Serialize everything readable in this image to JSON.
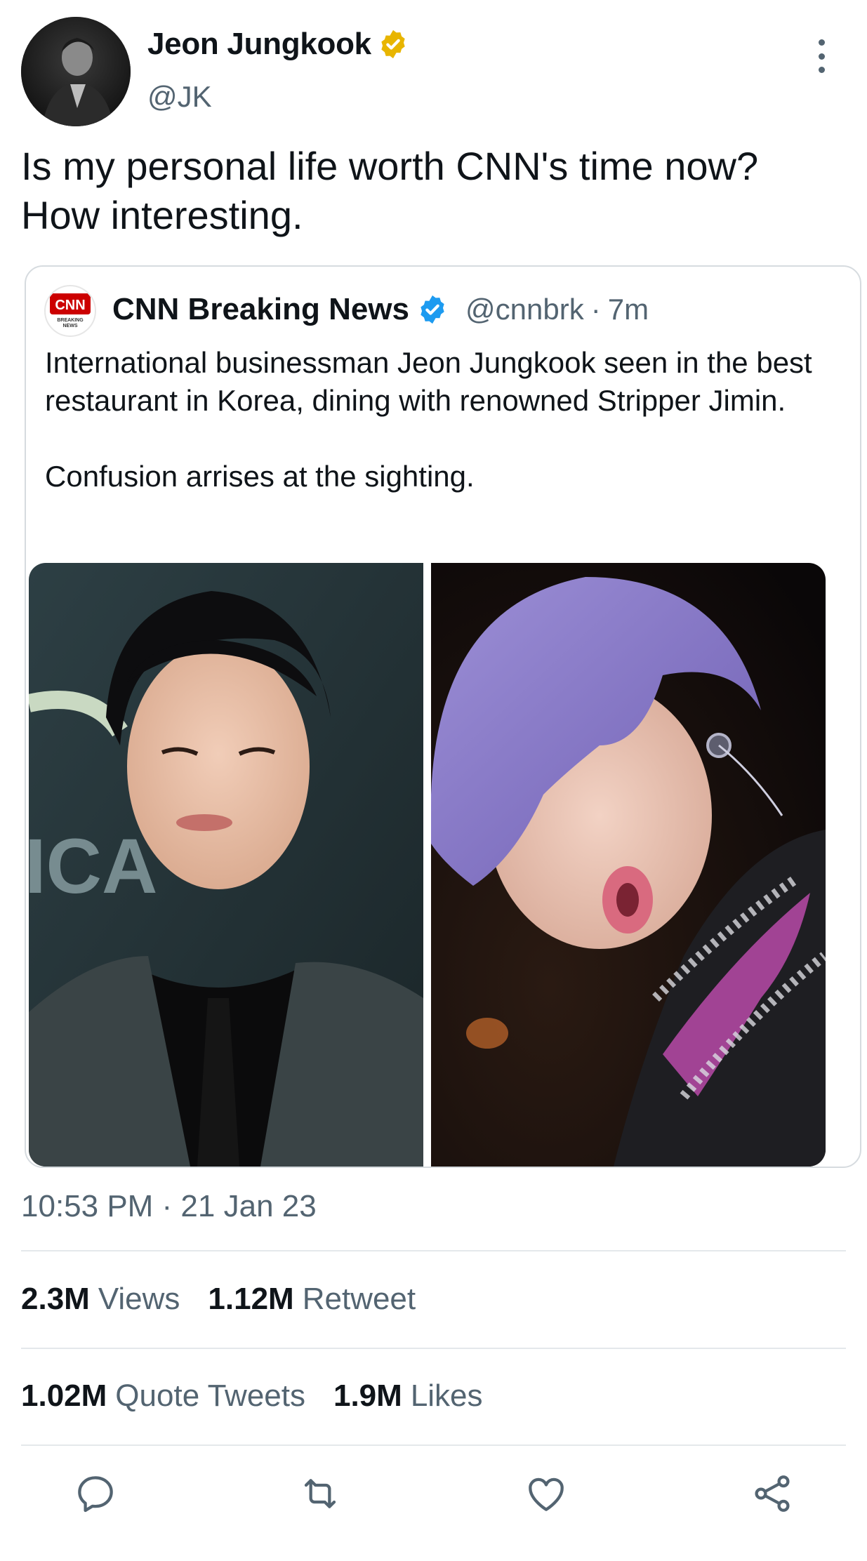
{
  "author": {
    "display_name": "Jeon Jungkook",
    "handle": "@JK",
    "verified_badge": "gold-check-icon",
    "avatar": "profile-photo"
  },
  "tweet": {
    "text": "Is my personal life worth CNN's time now?\nHow interesting.",
    "timestamp": "10:53 PM · 21 Jan 23"
  },
  "quoted_tweet": {
    "logo": "cnn-breaking-news-logo",
    "logo_text": "CNN",
    "logo_subtext": "BREAKING NEWS",
    "display_name": "CNN Breaking News",
    "verified_badge": "blue-check-icon",
    "handle": "@cnnbrk",
    "separator": "·",
    "time": "7m",
    "paragraphs": [
      "International businessman Jeon Jungkook seen in the best restaurant in Korea, dining with renowned Stripper Jimin.",
      "Confusion arrises at the sighting."
    ],
    "images": [
      "dark-haired-man-in-suit-photo",
      "purple-haired-performer-photo"
    ]
  },
  "stats": {
    "views_count": "2.3M",
    "views_label": "Views",
    "retweets_count": "1.12M",
    "retweets_label": "Retweet",
    "quotes_count": "1.02M",
    "quotes_label": "Quote Tweets",
    "likes_count": "1.9M",
    "likes_label": "Likes"
  },
  "actions": [
    "reply-icon",
    "retweet-icon",
    "like-icon",
    "share-icon"
  ],
  "colors": {
    "text": "#0f1419",
    "secondary": "#536471",
    "verified_gold": "#e8b500",
    "verified_blue": "#1d9bf0",
    "cnn_red": "#cc0000",
    "divider": "#e4e8eb"
  }
}
